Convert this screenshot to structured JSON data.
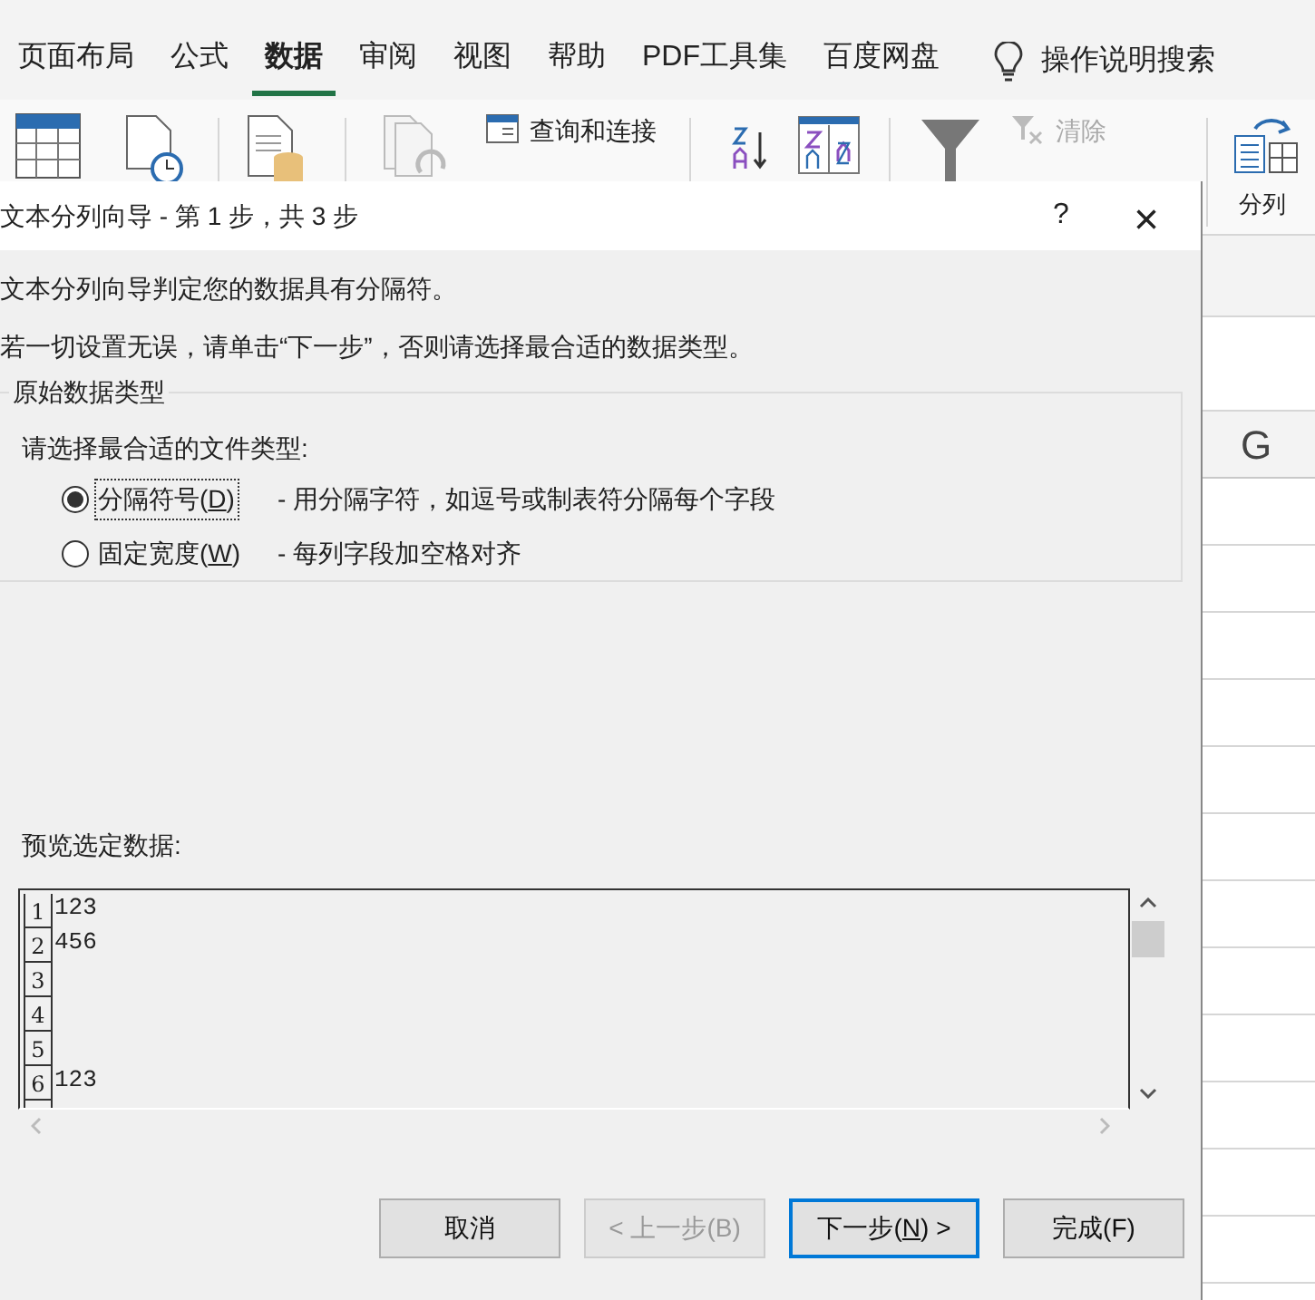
{
  "ribbon_tabs": [
    {
      "label": "页面布局",
      "selected": false
    },
    {
      "label": "公式",
      "selected": false
    },
    {
      "label": "数据",
      "selected": true
    },
    {
      "label": "审阅",
      "selected": false
    },
    {
      "label": "视图",
      "selected": false
    },
    {
      "label": "帮助",
      "selected": false
    },
    {
      "label": "PDF工具集",
      "selected": false
    },
    {
      "label": "百度网盘",
      "selected": false
    }
  ],
  "tell_me": "操作说明搜索",
  "ribbon_commands": [
    {
      "label": "查询和连接",
      "disabled": false
    },
    {
      "label": "清除",
      "disabled": true
    }
  ],
  "split_command": "分列",
  "sheet": {
    "column_header": "G"
  },
  "dialog": {
    "title": "文本分列向导 - 第 1 步，共 3 步",
    "help": "?",
    "close": "×",
    "intro": "文本分列向导判定您的数据具有分隔符。",
    "hint": "若一切设置无误，请单击“下一步”，否则请选择最合适的数据类型。",
    "group_title": "原始数据类型",
    "prompt": "请选择最合适的文件类型:",
    "options": [
      {
        "before": "分隔符号(",
        "accel": "D",
        "after": ")",
        "description": "- 用分隔字符，如逗号或制表符分隔每个字段",
        "selected": true
      },
      {
        "before": "固定宽度(",
        "accel": "W",
        "after": ")",
        "description": "- 每列字段加空格对齐",
        "selected": false
      }
    ],
    "preview_label": "预览选定数据:",
    "preview_rows": [
      {
        "number": "1",
        "text": "123"
      },
      {
        "number": "2",
        "text": "456"
      },
      {
        "number": "3"
      },
      {
        "number": "4"
      },
      {
        "number": "5"
      },
      {
        "number": "6",
        "text": "123"
      }
    ],
    "buttons": [
      {
        "before": "取消",
        "disabled": false,
        "default": false
      },
      {
        "before": "< 上一步(B)",
        "disabled": true,
        "default": false
      },
      {
        "before": "下一步(",
        "accel": "N",
        "after": ") >",
        "disabled": false,
        "default": true
      },
      {
        "before": "完成(F)",
        "disabled": false,
        "default": false
      }
    ]
  }
}
